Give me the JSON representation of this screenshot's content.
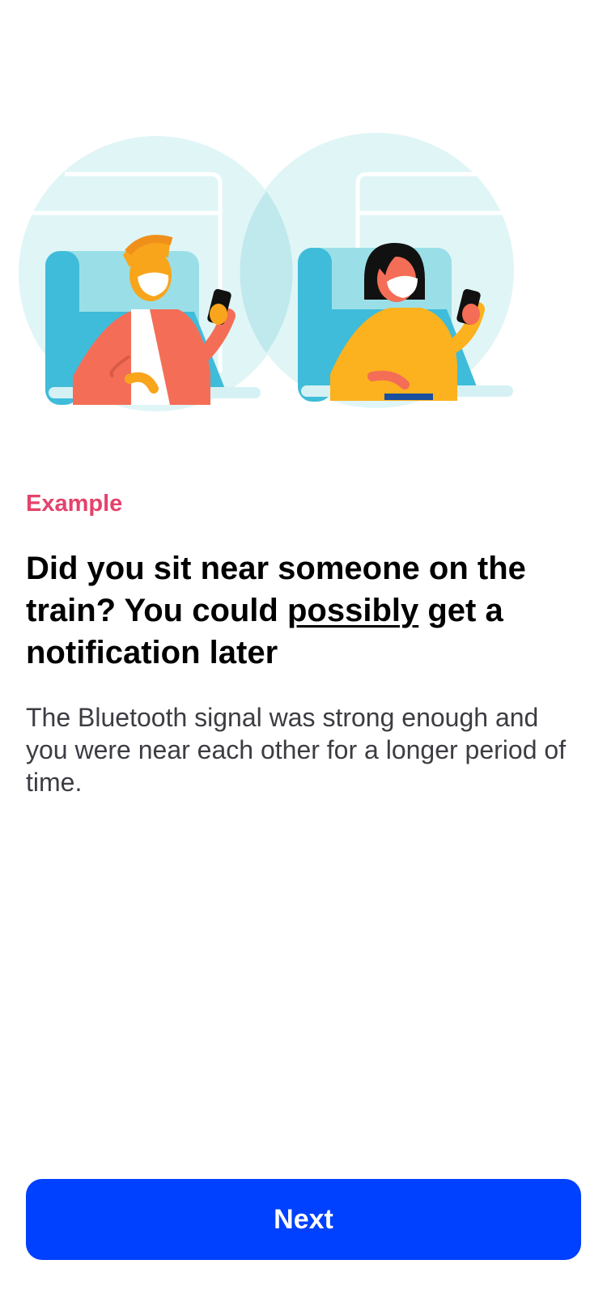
{
  "colors": {
    "accent": "#0040ff",
    "eyebrow": "#e5426b",
    "skin_man": "#f8a51b",
    "jacket_man": "#f46e57",
    "sweater_woman": "#fbb21e",
    "seat": "#3fbcd9",
    "seat_light": "#9adfe8",
    "circle_bg": "#e0f5f6"
  },
  "card": {
    "eyebrow": "Example",
    "headline": {
      "part1": "Did you sit near someone on the train? You could ",
      "emphasis": "possibly",
      "part2": " get a notification later"
    },
    "body": "The Bluetooth signal was strong enough and you were near each other for a longer period of time."
  },
  "actions": {
    "next_label": "Next"
  }
}
